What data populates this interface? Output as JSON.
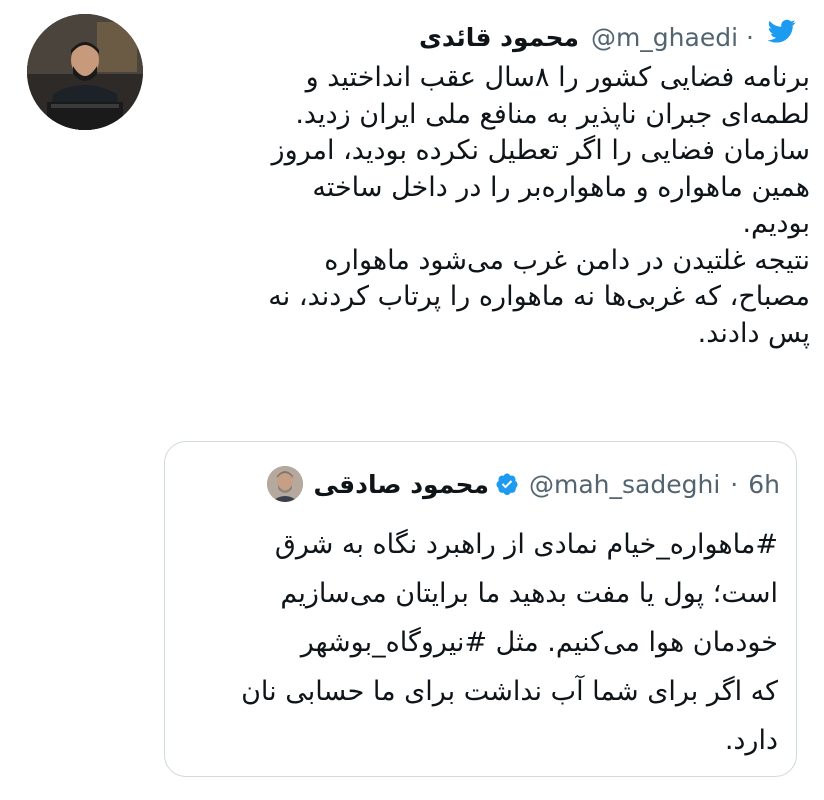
{
  "tweet": {
    "author_name": "محمود قائدی",
    "author_handle": "@m_ghaedi",
    "separator": "·",
    "lines": [
      "برنامه فضایی کشور را ۸سال عقب انداختید و",
      "لطمه‌ای جبران ناپذیر به منافع ملی ایران زدید.",
      "سازمان فضایی را اگر تعطیل نکرده بودید، امروز",
      "همین ماهواره و ماهواره‌بر را در داخل ساخته",
      "بودیم.",
      "نتیجه غلتیدن در دامن غرب می‌شود ماهواره",
      "مصباح، که غربی‌ها نه ماهواره را پرتاب کردند، نه",
      "پس دادند."
    ]
  },
  "quoted": {
    "author_name": "محمود صادقی",
    "author_handle": "@mah_sadeghi",
    "separator": "·",
    "time": "6h",
    "lines": [
      "#ماهواره_خیام نمادی از راهبرد نگاه به شرق",
      "است؛ پول یا مفت بدهید ما برایتان می‌سازیم",
      "خودمان هوا می‌کنیم. مثل #نیروگاه_بوشهر",
      "که اگر برای شما آب نداشت برای ما حسابی نان",
      "دارد."
    ]
  },
  "icons": {
    "platform": "twitter-bird-icon",
    "verified": "verified-badge-icon"
  },
  "colors": {
    "text": "#0f1419",
    "secondary": "#536471",
    "border": "#cfd9de",
    "twitter_blue": "#1d9bf0"
  }
}
